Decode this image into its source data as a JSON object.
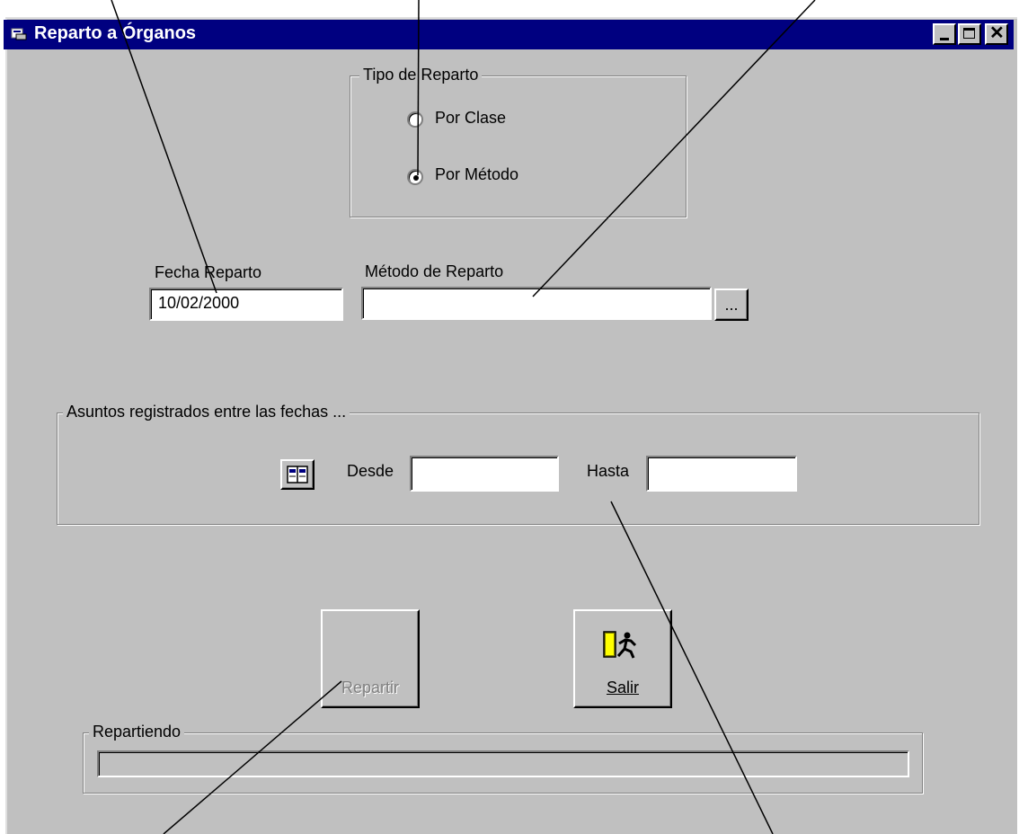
{
  "window": {
    "title": "Reparto a Órganos"
  },
  "tipo_reparto": {
    "legend": "Tipo de Reparto",
    "options": [
      {
        "label": "Por Clase",
        "selected": false
      },
      {
        "label": "Por Método",
        "selected": true
      }
    ]
  },
  "fecha_reparto": {
    "label": "Fecha Reparto",
    "value": "10/02/2000"
  },
  "metodo_reparto": {
    "label": "Método de Reparto",
    "value": "",
    "browse_label": "..."
  },
  "asuntos": {
    "legend": "Asuntos registrados entre las fechas ...",
    "desde_label": "Desde",
    "desde_value": "",
    "hasta_label": "Hasta",
    "hasta_value": ""
  },
  "buttons": {
    "repartir_label": "Repartir",
    "repartir_enabled": false,
    "salir_label": "Salir"
  },
  "progress": {
    "legend": "Repartiendo",
    "fraction": 0
  },
  "icons": {
    "window": "window-app-icon",
    "calendar": "calendar-book-icon",
    "exit": "exit-door-runner-icon"
  },
  "colors": {
    "titlebar": "#000080",
    "face": "#c0c0c0",
    "disabled_text": "#808080"
  }
}
